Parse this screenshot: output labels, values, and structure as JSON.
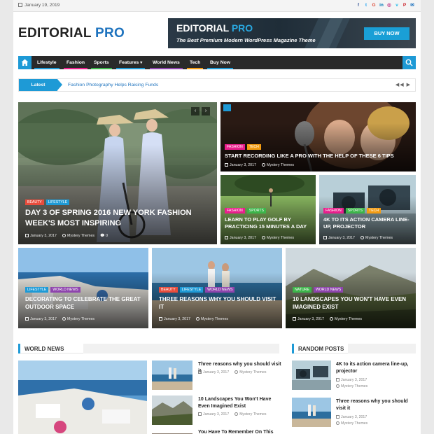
{
  "topbar": {
    "date": "January 19, 2019",
    "social_icons": [
      {
        "name": "facebook-icon",
        "glyph": "f",
        "color": "#3b5998"
      },
      {
        "name": "twitter-icon",
        "glyph": "t",
        "color": "#1da1f2"
      },
      {
        "name": "googleplus-icon",
        "glyph": "G",
        "color": "#dd4b39"
      },
      {
        "name": "linkedin-icon",
        "glyph": "in",
        "color": "#0077b5"
      },
      {
        "name": "instagram-icon",
        "glyph": "◎",
        "color": "#c13584"
      },
      {
        "name": "vimeo-icon",
        "glyph": "v",
        "color": "#1ab7ea"
      },
      {
        "name": "pinterest-icon",
        "glyph": "P",
        "color": "#cb2027"
      },
      {
        "name": "mail-icon",
        "glyph": "✉",
        "color": "#1e73be"
      }
    ]
  },
  "header": {
    "logo_main": "EDITORIAL",
    "logo_pro": "PRO",
    "banner_title_main": "EDITORIAL",
    "banner_title_pro": "PRO",
    "banner_subtitle": "The Best Premium Modern WordPress Magazine Theme",
    "banner_button": "BUY NOW"
  },
  "nav": {
    "items": [
      {
        "label": "Lifestyle",
        "color": "#1e9ad6"
      },
      {
        "label": "Fashion",
        "color": "#e91e8c"
      },
      {
        "label": "Sports",
        "color": "#3cb54a"
      },
      {
        "label": "Features",
        "color": "#1e9ad6"
      },
      {
        "label": "World News",
        "color": "#8e44ad"
      },
      {
        "label": "Tech",
        "color": "#f39c12"
      },
      {
        "label": "Buy Now",
        "color": "#1e9ad6"
      }
    ]
  },
  "ticker": {
    "label": "Latest",
    "text": "Fashion Photography Helps Raising Funds",
    "controls": "◀◀ ▶"
  },
  "featured": {
    "main": {
      "tags": [
        {
          "label": "BEAUTY",
          "color": "#e74c3c"
        },
        {
          "label": "LIFESTYLE",
          "color": "#1e9ad6"
        }
      ],
      "title": "DAY 3 OF SPRING 2016 NEW YORK FASHION WEEK'S MOST INSPIRING",
      "date": "January 3, 2017",
      "author": "Mystery Themes",
      "comments": "0"
    },
    "top_right": {
      "tags": [
        {
          "label": "FASHION",
          "color": "#e91e8c"
        },
        {
          "label": "TECH",
          "color": "#f39c12"
        }
      ],
      "title": "START RECORDING LIKE A PRO WITH THE HELP OF THESE 6 TIPS",
      "date": "January 3, 2017",
      "author": "Mystery Themes"
    },
    "mid_left": {
      "tags": [
        {
          "label": "FASHION",
          "color": "#e91e8c"
        },
        {
          "label": "SPORTS",
          "color": "#3cb54a"
        }
      ],
      "title": "LEARN TO PLAY GOLF BY PRACTICING 15 MINUTES A DAY",
      "date": "January 3, 2017",
      "author": "Mystery Themes"
    },
    "mid_right": {
      "tags": [
        {
          "label": "FASHION",
          "color": "#e91e8c"
        },
        {
          "label": "SPORTS",
          "color": "#3cb54a"
        },
        {
          "label": "TECH",
          "color": "#f39c12"
        }
      ],
      "title": "4K TO ITS ACTION CAMERA LINE-UP, PROJECTOR",
      "date": "January 3, 2017",
      "author": "Mystery Themes"
    }
  },
  "row3": [
    {
      "tags": [
        {
          "label": "LIFESTYLE",
          "color": "#1e9ad6"
        },
        {
          "label": "WORLD NEWS",
          "color": "#8e44ad"
        }
      ],
      "title": "DECORATING TO CELEBRATE THE GREAT OUTDOOR SPACE",
      "date": "January 3, 2017",
      "author": "Mystery Themes"
    },
    {
      "tags": [
        {
          "label": "BEAUTY",
          "color": "#e74c3c"
        },
        {
          "label": "LIFESTYLE",
          "color": "#1e9ad6"
        },
        {
          "label": "WORLD NEWS",
          "color": "#8e44ad"
        }
      ],
      "title": "THREE REASONS WHY YOU SHOULD VISIT IT",
      "date": "January 3, 2017",
      "author": "Mystery Themes"
    },
    {
      "tags": [
        {
          "label": "NATURE",
          "color": "#3cb54a"
        },
        {
          "label": "WORLD NEWS",
          "color": "#8e44ad"
        }
      ],
      "title": "10 LANDSCAPES YOU WON'T HAVE EVEN IMAGINED EXIST",
      "date": "January 3, 2017",
      "author": "Mystery Themes"
    }
  ],
  "world_news": {
    "title": "WORLD NEWS",
    "items": [
      {
        "title": "Three reasons why you should visit it",
        "date": "January 3, 2017",
        "author": "Mystery Themes"
      },
      {
        "title": "10 Landscapes You Won't Have Even Imagined Exist",
        "date": "January 3, 2017",
        "author": "Mystery Themes"
      },
      {
        "title": "You Have To Remember On This"
      }
    ]
  },
  "random_posts": {
    "title": "RANDOM POSTS",
    "items": [
      {
        "title": "4K to its action camera line-up, projector",
        "date": "January 3, 2017",
        "author": "Mystery Themes"
      },
      {
        "title": "Three reasons why you should visit it",
        "date": "January 3, 2017",
        "author": "Mystery Themes"
      }
    ]
  }
}
